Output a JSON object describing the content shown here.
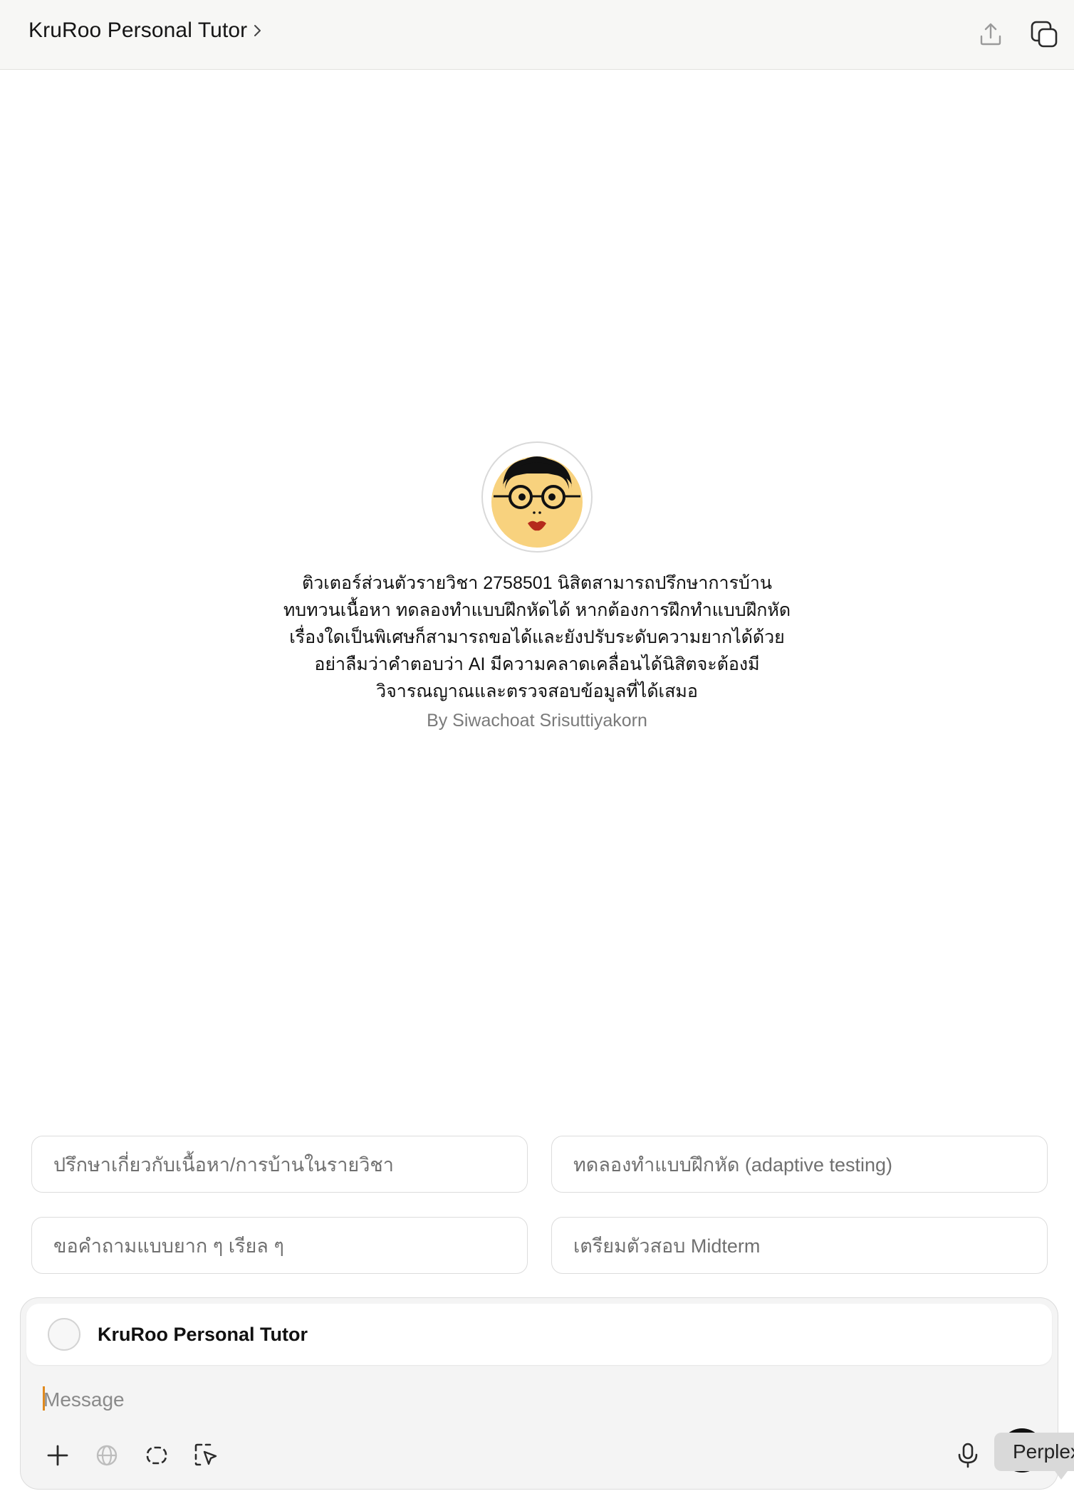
{
  "header": {
    "title": "KruRoo Personal Tutor",
    "title_chevron_icon": "chevron-right-icon",
    "share_icon": "share-upload-icon",
    "new_chat_icon": "new-chat-icon"
  },
  "gpt": {
    "avatar_icon": "tutor-cartoon-face",
    "description": "ติวเตอร์ส่วนตัวรายวิชา 2758501 นิสิตสามารถปรึกษาการบ้าน ทบทวนเนื้อหา ทดลองทำแบบฝึกหัดได้ หากต้องการฝึกทำแบบฝึกหัดเรื่องใดเป็นพิเศษก็สามารถขอได้และยังปรับระดับความยากได้ด้วย อย่าลืมว่าคำตอบว่า AI มีความคลาดเคลื่อนได้นิสิตจะต้องมีวิจารณญาณและตรวจสอบข้อมูลที่ได้เสมอ",
    "byline": "By Siwachoat Srisuttiyakorn"
  },
  "suggestions": [
    {
      "label": "ปรึกษาเกี่ยวกับเนื้อหา/การบ้านในรายวิชา"
    },
    {
      "label": "ทดลองทำแบบฝึกหัด (adaptive testing)"
    },
    {
      "label": "ขอคำถามแบบยาก ๆ เรียล ๆ"
    },
    {
      "label": "เตรียมตัวสอบ Midterm"
    }
  ],
  "composer": {
    "gpt_name": "KruRoo Personal Tutor",
    "placeholder": "Message",
    "value": "",
    "tools": [
      "plus-icon",
      "globe-icon",
      "loop-icon",
      "select-cursor-icon",
      "microphone-icon"
    ],
    "tooltip": "Perplexity"
  },
  "colors": {
    "caret": "#e08a1e",
    "topbar_bg": "#f7f7f5",
    "composer_bg": "#f4f4f4"
  }
}
